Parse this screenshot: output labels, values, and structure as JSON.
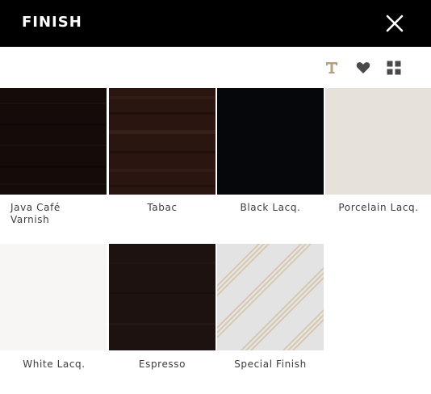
{
  "header": {
    "title": "FINISH"
  },
  "icons": {
    "close": "close-icon",
    "text_view": "text-view-icon",
    "favorites": "heart-icon",
    "grid_view": "grid-view-icon"
  },
  "colors": {
    "header_bg": "#000000",
    "icon_gold": "#b4a27f",
    "icon_dark": "#4a4a4a"
  },
  "finishes": [
    {
      "name": "Java Café Varnish",
      "line1": "Java Café",
      "line2": "Varnish",
      "swatch_color": "#150c0a"
    },
    {
      "name": "Tabac",
      "swatch_color": "#2a1510"
    },
    {
      "name": "Black Lacq.",
      "swatch_color": "#05070b"
    },
    {
      "name": "Porcelain Lacq.",
      "swatch_color": "#e6e1d9"
    },
    {
      "name": "White Lacq.",
      "swatch_color": "#f7f6f4"
    },
    {
      "name": "Espresso",
      "swatch_color": "#1d1210"
    },
    {
      "name": "Special Finish",
      "swatch_color": "#e3e3e3"
    }
  ]
}
